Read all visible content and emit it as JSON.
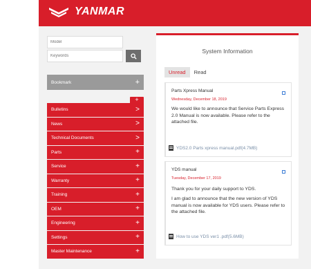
{
  "header": {
    "brand": "YANMAR"
  },
  "search": {
    "model_placeholder": "Model",
    "keywords_placeholder": "Keywords"
  },
  "bookmark": {
    "label": "Bookmark",
    "indicator": "+"
  },
  "menu": {
    "add_label": "+",
    "items": [
      {
        "label": "Bulletins",
        "indicator": ">"
      },
      {
        "label": "News",
        "indicator": ">"
      },
      {
        "label": "Technical Documents",
        "indicator": ">"
      },
      {
        "label": "Parts",
        "indicator": "+"
      },
      {
        "label": "Service",
        "indicator": "+"
      },
      {
        "label": "Warranty",
        "indicator": "+"
      },
      {
        "label": "Training",
        "indicator": "+"
      },
      {
        "label": "OEM",
        "indicator": "+"
      },
      {
        "label": "Engineering",
        "indicator": "+"
      },
      {
        "label": "Settings",
        "indicator": "+"
      },
      {
        "label": "Master Maintenance",
        "indicator": "+"
      }
    ]
  },
  "panel": {
    "title": "System Information",
    "tabs": [
      {
        "label": "Unread"
      },
      {
        "label": "Read"
      }
    ],
    "cards": [
      {
        "title": "Parts Xpress Manual",
        "date": "Wednesday, December 18, 2019",
        "body": "We would like to announce that Service Parts Express 2.0 Manual is now available. Please refer to the attached file.",
        "attachment": "YDS2.0 Parts xpress manual.pdf(4.7MB)"
      },
      {
        "title": "YDS manual",
        "date": "Tuesday, December 17, 2019",
        "body_1": "Thank you for your daily support to YDS.",
        "body_2": "I am glad to announce that the new version of YDS manual is now available for YDS users. Please refer to the attached file.",
        "attachment": "How to use YDS ver1 .pdf(5.6MB)"
      }
    ]
  },
  "colors": {
    "accent": "#d81e2a",
    "sidebar_gray": "#9a9a9a",
    "background": "#f2f2f2"
  }
}
